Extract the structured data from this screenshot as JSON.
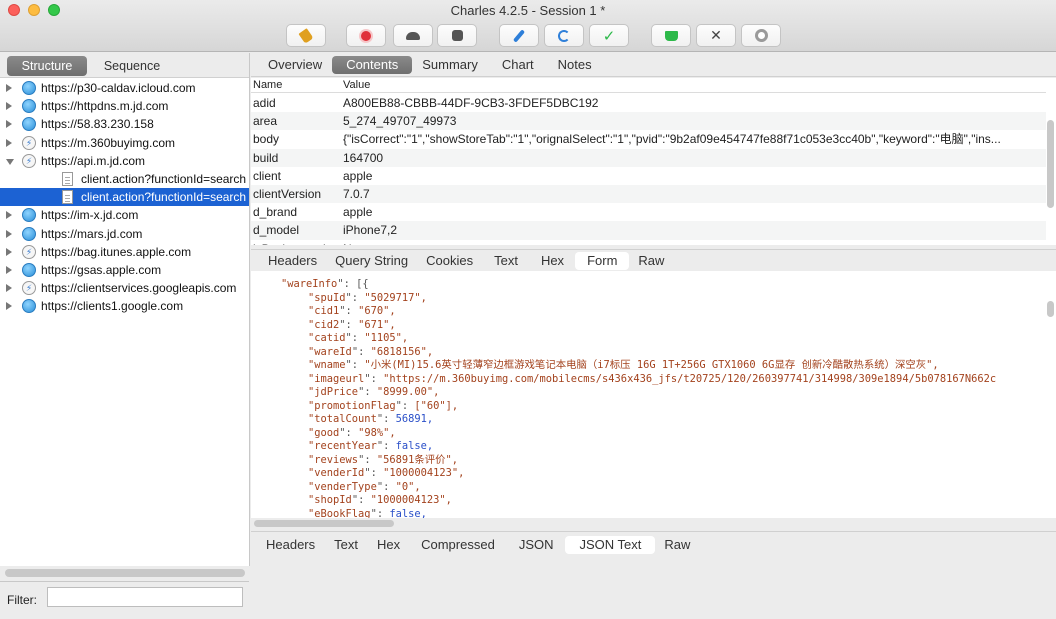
{
  "window": {
    "title": "Charles 4.2.5 - Session 1 *"
  },
  "toolbar": {
    "icons": [
      "broom-icon",
      "record-icon",
      "throttle-icon",
      "stop-icon",
      "compose-icon",
      "repeat-icon",
      "validate-icon",
      "basket-icon",
      "tools-icon",
      "settings-icon"
    ]
  },
  "left": {
    "tabs": [
      "Structure",
      "Sequence"
    ],
    "tree": [
      {
        "label": "https://p30-caldav.icloud.com",
        "icon": "globe",
        "arrow": "r",
        "indent": 0
      },
      {
        "label": "https://httpdns.m.jd.com",
        "icon": "globe",
        "arrow": "r",
        "indent": 0
      },
      {
        "label": "https://58.83.230.158",
        "icon": "globe",
        "arrow": "r",
        "indent": 0
      },
      {
        "label": "https://m.360buyimg.com",
        "icon": "bolt",
        "arrow": "r",
        "indent": 0
      },
      {
        "label": "https://api.m.jd.com",
        "icon": "bolt",
        "arrow": "d",
        "indent": 0
      },
      {
        "label": "client.action?functionId=search",
        "icon": "doc",
        "arrow": "",
        "indent": 1
      },
      {
        "label": "client.action?functionId=search",
        "icon": "doc",
        "arrow": "",
        "indent": 1,
        "selected": true
      },
      {
        "label": "https://im-x.jd.com",
        "icon": "globe",
        "arrow": "r",
        "indent": 0
      },
      {
        "label": "https://mars.jd.com",
        "icon": "globe",
        "arrow": "r",
        "indent": 0
      },
      {
        "label": "https://bag.itunes.apple.com",
        "icon": "bolt",
        "arrow": "r",
        "indent": 0
      },
      {
        "label": "https://gsas.apple.com",
        "icon": "globe",
        "arrow": "r",
        "indent": 0
      },
      {
        "label": "https://clientservices.googleapis.com",
        "icon": "bolt",
        "arrow": "r",
        "indent": 0
      },
      {
        "label": "https://clients1.google.com",
        "icon": "globe",
        "arrow": "r",
        "indent": 0
      }
    ],
    "filter_label": "Filter:",
    "filter_value": ""
  },
  "right": {
    "top_tabs": [
      "Overview",
      "Contents",
      "Summary",
      "Chart",
      "Notes"
    ],
    "grid_header": {
      "name": "Name",
      "value": "Value"
    },
    "grid_rows": [
      {
        "name": "adid",
        "value": "A800EB88-CBBB-44DF-9CB3-3FDEF5DBC192"
      },
      {
        "name": "area",
        "value": "5_274_49707_49973"
      },
      {
        "name": "body",
        "value": "{\"isCorrect\":\"1\",\"showStoreTab\":\"1\",\"orignalSelect\":\"1\",\"pvid\":\"9b2af09e454747fe88f71c053e3cc40b\",\"keyword\":\"电脑\",\"ins..."
      },
      {
        "name": "build",
        "value": "164700"
      },
      {
        "name": "client",
        "value": "apple"
      },
      {
        "name": "clientVersion",
        "value": "7.0.7"
      },
      {
        "name": "d_brand",
        "value": "apple"
      },
      {
        "name": "d_model",
        "value": "iPhone7,2"
      },
      {
        "name": "isBackground",
        "value": "N"
      }
    ],
    "mid_tabs": [
      "Headers",
      "Query String",
      "Cookies",
      "Text",
      "Hex",
      "Form",
      "Raw"
    ],
    "json_lines": [
      {
        "i": 1,
        "k": "wareInfo",
        "v": "[{",
        "t": "p"
      },
      {
        "i": 2,
        "k": "spuId",
        "v": "\"5029717\",",
        "t": "s"
      },
      {
        "i": 2,
        "k": "cid1",
        "v": "\"670\",",
        "t": "s"
      },
      {
        "i": 2,
        "k": "cid2",
        "v": "\"671\",",
        "t": "s"
      },
      {
        "i": 2,
        "k": "catid",
        "v": "\"1105\",",
        "t": "s"
      },
      {
        "i": 2,
        "k": "wareId",
        "v": "\"6818156\",",
        "t": "s"
      },
      {
        "i": 2,
        "k": "wname",
        "v": "\"小米(MI)15.6英寸轻薄窄边框游戏笔记本电脑（i7标压 16G 1T+256G GTX1060 6G显存 创新冷酷散热系统）深空灰\",",
        "t": "s"
      },
      {
        "i": 2,
        "k": "imageurl",
        "v": "\"https://m.360buyimg.com/mobilecms/s436x436_jfs/t20725/120/260397741/314998/309e1894/5b078167N662c",
        "t": "s"
      },
      {
        "i": 2,
        "k": "jdPrice",
        "v": "\"8999.00\",",
        "t": "s"
      },
      {
        "i": 2,
        "k": "promotionFlag",
        "v": "[\"60\"],",
        "t": "s"
      },
      {
        "i": 2,
        "k": "totalCount",
        "v": "56891,",
        "t": "n"
      },
      {
        "i": 2,
        "k": "good",
        "v": "\"98%\",",
        "t": "s"
      },
      {
        "i": 2,
        "k": "recentYear",
        "v": "false,",
        "t": "b"
      },
      {
        "i": 2,
        "k": "reviews",
        "v": "\"56891条评价\",",
        "t": "s"
      },
      {
        "i": 2,
        "k": "venderId",
        "v": "\"1000004123\",",
        "t": "s"
      },
      {
        "i": 2,
        "k": "venderType",
        "v": "\"0\",",
        "t": "s"
      },
      {
        "i": 2,
        "k": "shopId",
        "v": "\"1000004123\",",
        "t": "s"
      },
      {
        "i": 2,
        "k": "eBookFlag",
        "v": "false,",
        "t": "b"
      }
    ],
    "bottom_tabs": [
      "Headers",
      "Text",
      "Hex",
      "Compressed",
      "JSON",
      "JSON Text",
      "Raw"
    ]
  }
}
